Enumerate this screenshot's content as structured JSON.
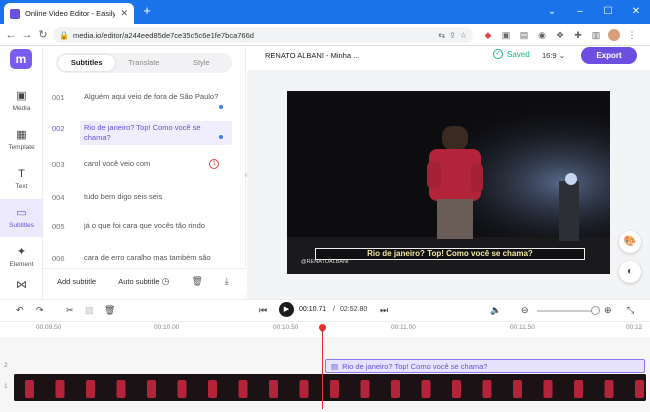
{
  "browser": {
    "tab_title": "Online Video Editor - Easily Edi",
    "url": "media.io/editor/a244eed85de7ce35c5c6e1fe7bca766d",
    "new_tab": "+",
    "close": "✕"
  },
  "rail": {
    "items": [
      {
        "label": "Media",
        "icon": "media-icon"
      },
      {
        "label": "Template",
        "icon": "template-icon"
      },
      {
        "label": "Text",
        "icon": "text-icon"
      },
      {
        "label": "Subtitles",
        "icon": "subtitles-icon"
      },
      {
        "label": "Element",
        "icon": "element-icon"
      }
    ],
    "logo": "m"
  },
  "panel": {
    "tabs": [
      "Subtitles",
      "Translate",
      "Style"
    ],
    "active_tab": "Subtitles",
    "subtitles": [
      {
        "num": "001",
        "text": "Alguém aqui veio de fora de São Paulo?"
      },
      {
        "num": "002",
        "text": "Rio de janeiro? Top! Como você se chama?"
      },
      {
        "num": "003",
        "text": "carol você veio com"
      },
      {
        "num": "004",
        "text": "tudo bem digo seis seis"
      },
      {
        "num": "005",
        "text": "já o que foi cara que vocês tão rindo"
      },
      {
        "num": "006",
        "text": "cara de erro caralho mas também são"
      }
    ],
    "warning_count": "1",
    "footer": {
      "add": "Add subtitle",
      "auto": "Auto subtitle"
    }
  },
  "topbar": {
    "project_title": "RENATO ALBANI - Minha ...",
    "saved": "Saved",
    "aspect": "16:9",
    "export": "Export"
  },
  "video": {
    "subtitle": "Rio de janeiro? Top! Como você se chama?",
    "watermark": "@RENATOALBANI"
  },
  "playback": {
    "current": "00:10.71",
    "separator": "/",
    "total": "02:52.80"
  },
  "timeline": {
    "ticks": [
      "00:09.50",
      "00:10.00",
      "00:10.50",
      "00:11.00",
      "00:11.50",
      "00:12"
    ],
    "track_labels": [
      "2",
      "1"
    ],
    "subtitle_clip": "Rio de janeiro? Top! Como você se chama?"
  },
  "colors": {
    "accent": "#6c4fe0",
    "saved": "#1fb58a",
    "chrome": "#1a73e8"
  }
}
